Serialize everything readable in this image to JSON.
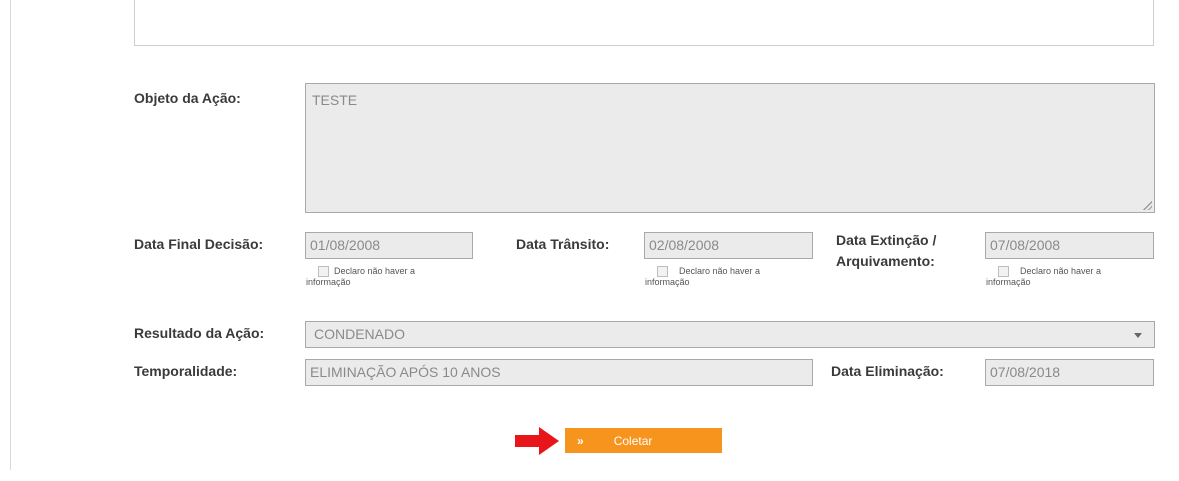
{
  "form": {
    "objeto_label": "Objeto da Ação:",
    "objeto_value": "TESTE",
    "data_final_label": "Data Final Decisão:",
    "data_final_value": "01/08/2008",
    "data_transito_label": "Data Trânsito:",
    "data_transito_value": "02/08/2008",
    "data_extincao_label_line1": "Data Extinção /",
    "data_extincao_label_line2": "Arquivamento:",
    "data_extincao_value": "07/08/2008",
    "checkbox_line1": "Declaro não haver a",
    "checkbox_line2": "informação",
    "resultado_label": "Resultado da Ação:",
    "resultado_value": "CONDENADO",
    "temporalidade_label": "Temporalidade:",
    "temporalidade_value": "ELIMINAÇÃO APÓS 10 ANOS",
    "data_eliminacao_label": "Data Eliminação:",
    "data_eliminacao_value": "07/08/2018"
  },
  "actions": {
    "coletar_label": "Coletar",
    "coletar_chevron": "»"
  },
  "colors": {
    "button": "#f7941d",
    "arrow": "#e8161b",
    "field_bg": "#ebebeb"
  },
  "icons": {
    "pointer": "red-arrow-right-icon",
    "dropdown": "chevron-down-icon"
  }
}
